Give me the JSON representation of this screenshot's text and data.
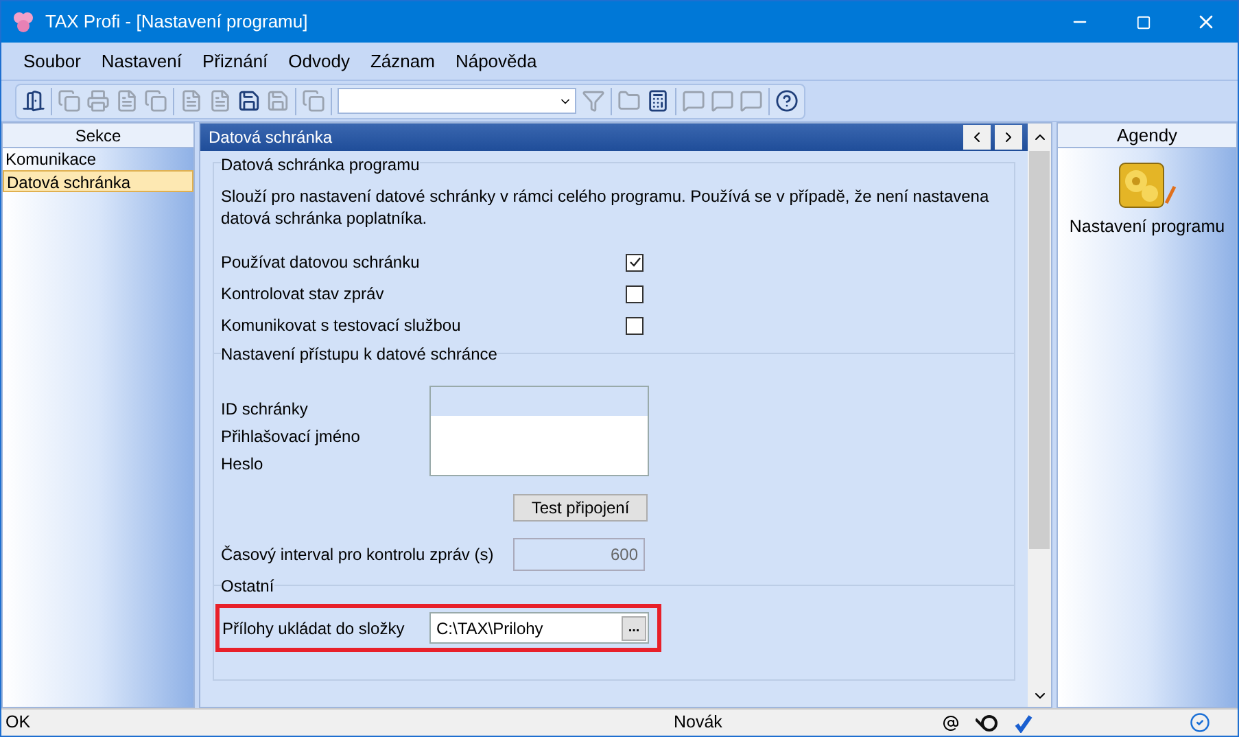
{
  "window": {
    "title": "TAX Profi - [Nastavení programu]"
  },
  "menu": [
    "Soubor",
    "Nastavení",
    "Přiznání",
    "Odvody",
    "Záznam",
    "Nápověda"
  ],
  "toolbar": [
    {
      "kind": "icon",
      "disabled": false
    },
    {
      "kind": "separator"
    },
    {
      "kind": "icon",
      "disabled": true
    },
    {
      "kind": "icon",
      "disabled": true
    },
    {
      "kind": "icon",
      "disabled": true
    },
    {
      "kind": "icon",
      "disabled": true
    },
    {
      "kind": "separator"
    },
    {
      "kind": "icon",
      "disabled": true
    },
    {
      "kind": "icon",
      "disabled": true
    },
    {
      "kind": "icon",
      "disabled": false
    },
    {
      "kind": "icon",
      "disabled": true
    },
    {
      "kind": "separator"
    },
    {
      "kind": "icon",
      "disabled": true
    },
    {
      "kind": "separator"
    },
    {
      "kind": "combo"
    },
    {
      "kind": "icon",
      "disabled": true
    },
    {
      "kind": "separator"
    },
    {
      "kind": "icon",
      "disabled": true
    },
    {
      "kind": "icon",
      "disabled": false
    },
    {
      "kind": "separator"
    },
    {
      "kind": "icon",
      "disabled": true
    },
    {
      "kind": "icon",
      "disabled": true
    },
    {
      "kind": "icon",
      "disabled": true
    },
    {
      "kind": "separator"
    },
    {
      "kind": "icon",
      "disabled": false
    }
  ],
  "sidebar": {
    "title": "Sekce",
    "items": [
      {
        "label": "Komunikace",
        "selected": false
      },
      {
        "label": "Datová schránka",
        "selected": true
      }
    ]
  },
  "panel": {
    "title": "Datová schránka",
    "group1": {
      "title": "Datová schránka programu",
      "description": "Slouží pro nastavení datové schránky v rámci celého programu. Používá se v případě, že není nastavena datová schránka poplatníka.",
      "options": [
        {
          "label": "Používat datovou schránku",
          "checked": true
        },
        {
          "label": "Kontrolovat stav zpráv",
          "checked": false
        },
        {
          "label": "Komunikovat s testovací službou",
          "checked": false
        }
      ]
    },
    "group2": {
      "title": "Nastavení přístupu k datové schránce",
      "fields": [
        {
          "label": "ID schránky"
        },
        {
          "label": "Přihlašovací jméno"
        },
        {
          "label": "Heslo"
        }
      ],
      "test_button": "Test připojení",
      "interval_label": "Časový interval pro kontrolu zpráv (s)",
      "interval_value": "600"
    },
    "group3": {
      "title": "Ostatní",
      "folder_label": "Přílohy ukládat do složky",
      "folder_value": "C:\\TAX\\Prilohy",
      "browse_button": "..."
    }
  },
  "agendy": {
    "title": "Agendy",
    "items": [
      {
        "label": "Nastavení programu"
      }
    ]
  },
  "status_bar": {
    "message": "OK",
    "user": "Novák"
  }
}
